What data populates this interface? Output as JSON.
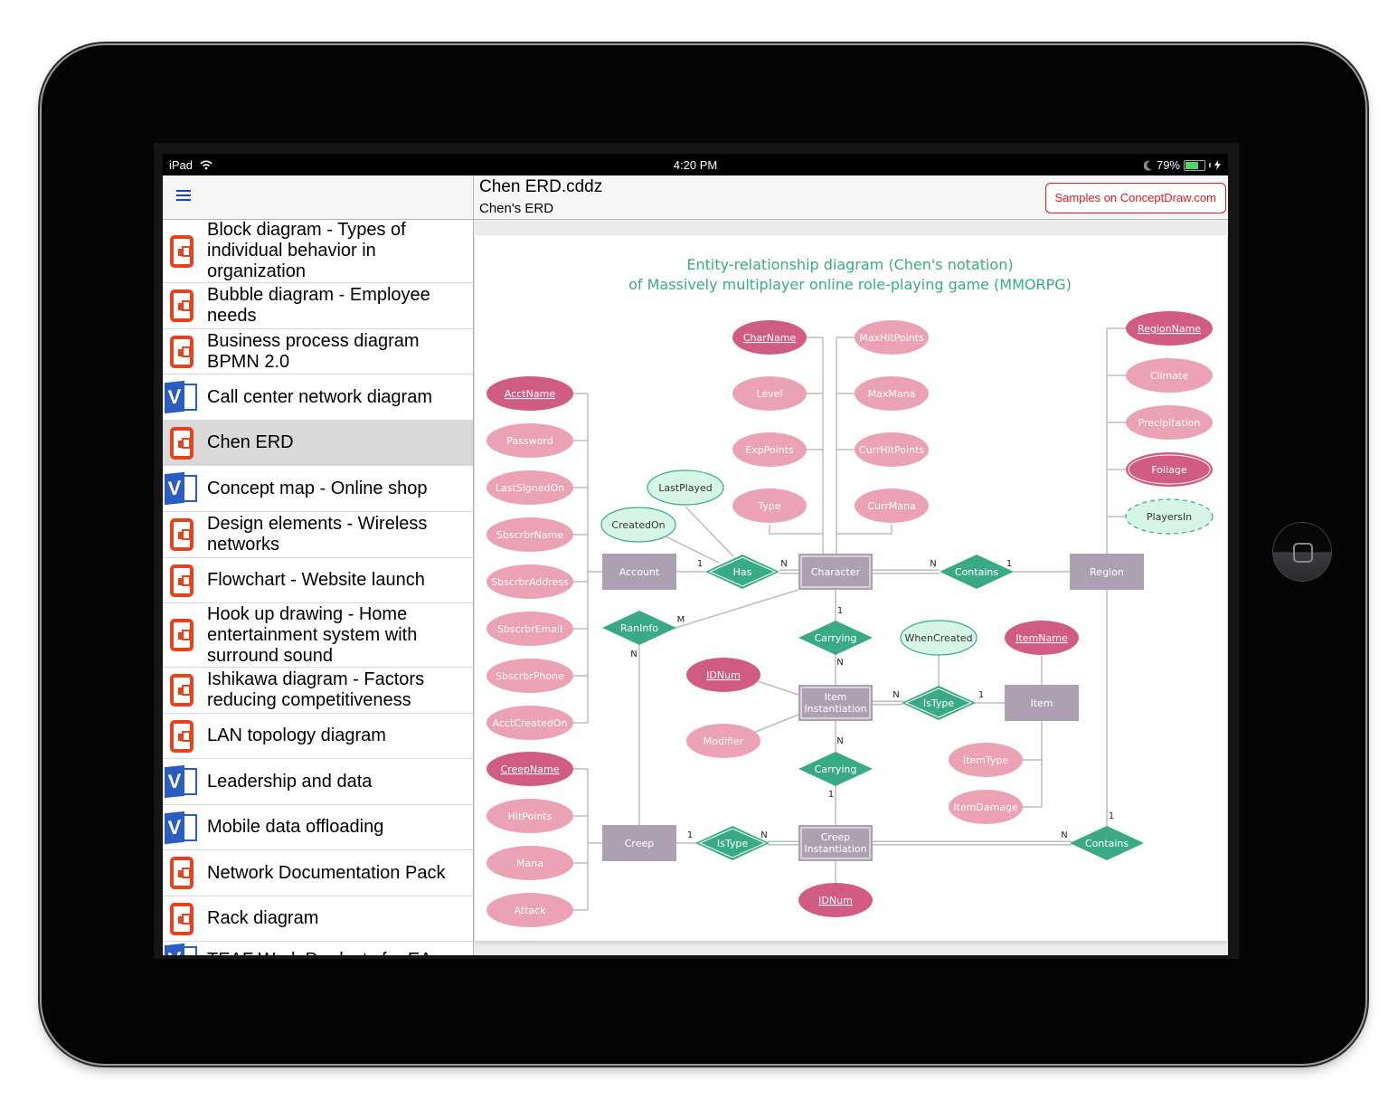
{
  "status_bar": {
    "device": "iPad",
    "time": "4:20 PM",
    "battery": "79%",
    "battery_level": 0.79,
    "icons": [
      "wifi-icon",
      "moon-icon",
      "battery-icon",
      "charging-icon"
    ]
  },
  "sidebar": {
    "menu_icon": "hamburger-menu-icon",
    "items": [
      {
        "label": "Block diagram - Types of individual behavior in organization",
        "icon": "conceptdraw-doc-icon",
        "selected": false
      },
      {
        "label": "Bubble diagram - Employee needs",
        "icon": "conceptdraw-doc-icon",
        "selected": false
      },
      {
        "label": "Business process diagram BPMN 2.0",
        "icon": "conceptdraw-doc-icon",
        "selected": false
      },
      {
        "label": "Call center network diagram",
        "icon": "visio-doc-icon",
        "selected": false
      },
      {
        "label": "Chen ERD",
        "icon": "conceptdraw-doc-icon",
        "selected": true
      },
      {
        "label": "Concept map - Online shop",
        "icon": "visio-doc-icon",
        "selected": false
      },
      {
        "label": "Design elements - Wireless networks",
        "icon": "conceptdraw-doc-icon",
        "selected": false
      },
      {
        "label": "Flowchart - Website launch",
        "icon": "conceptdraw-doc-icon",
        "selected": false
      },
      {
        "label": "Hook up drawing - Home entertainment system with surround sound",
        "icon": "conceptdraw-doc-icon",
        "selected": false
      },
      {
        "label": "Ishikawa diagram - Factors reducing competitiveness",
        "icon": "conceptdraw-doc-icon",
        "selected": false
      },
      {
        "label": "LAN topology diagram",
        "icon": "conceptdraw-doc-icon",
        "selected": false
      },
      {
        "label": "Leadership and data",
        "icon": "visio-doc-icon",
        "selected": false
      },
      {
        "label": "Mobile data offloading",
        "icon": "visio-doc-icon",
        "selected": false
      },
      {
        "label": "Network Documentation Pack",
        "icon": "conceptdraw-doc-icon",
        "selected": false
      },
      {
        "label": "Rack diagram",
        "icon": "conceptdraw-doc-icon",
        "selected": false
      },
      {
        "label": "TEAF Work Products for EA",
        "icon": "visio-doc-icon",
        "selected": false
      }
    ]
  },
  "main": {
    "file_name": "Chen ERD.cddz",
    "page_name": "Chen's ERD",
    "samples_button": "Samples on ConceptDraw.com",
    "colors": {
      "accent_red": "#e3191f",
      "entity": "#ada0b2",
      "relationship": "#3aaa86",
      "key_attr": "#d05c84",
      "attr": "#eaa2b4",
      "derived_attr": "#d7f5e6"
    }
  },
  "diagram": {
    "title_line1": "Entity-relationship diagram (Chen's notation)",
    "title_line2": "of Massively multiplayer online role-playing game (MMORPG)",
    "entities": [
      {
        "id": "account",
        "label": "Account",
        "weak": false
      },
      {
        "id": "character",
        "label": "Character",
        "weak": true
      },
      {
        "id": "region",
        "label": "Region",
        "weak": false
      },
      {
        "id": "item_inst",
        "label": "Item Instantiation",
        "weak": true
      },
      {
        "id": "item",
        "label": "Item",
        "weak": false
      },
      {
        "id": "creep",
        "label": "Creep",
        "weak": false
      },
      {
        "id": "creep_inst",
        "label": "Creep Instantiation",
        "weak": true
      }
    ],
    "relationships": [
      {
        "id": "has",
        "label": "Has",
        "identifying": true
      },
      {
        "id": "contains1",
        "label": "Contains",
        "identifying": false
      },
      {
        "id": "raninfo",
        "label": "RanInfo",
        "identifying": false
      },
      {
        "id": "carrying1",
        "label": "Carrying",
        "identifying": false
      },
      {
        "id": "istype1",
        "label": "IsType",
        "identifying": true
      },
      {
        "id": "carrying2",
        "label": "Carrying",
        "identifying": false
      },
      {
        "id": "istype2",
        "label": "IsType",
        "identifying": true
      },
      {
        "id": "contains2",
        "label": "Contains",
        "identifying": false
      }
    ],
    "attributes": [
      {
        "id": "acctname",
        "label": "AcctName",
        "type": "key"
      },
      {
        "id": "password",
        "label": "Password",
        "type": "normal"
      },
      {
        "id": "lastsignedon",
        "label": "LastSignedOn",
        "type": "normal"
      },
      {
        "id": "sbscrbrname",
        "label": "SbscrbrName",
        "type": "normal"
      },
      {
        "id": "sbscrbraddress",
        "label": "SbscrbrAddress",
        "type": "normal"
      },
      {
        "id": "sbscrbremail",
        "label": "SbscrbrEmail",
        "type": "normal"
      },
      {
        "id": "sbscrbrphone",
        "label": "SbscrbrPhone",
        "type": "normal"
      },
      {
        "id": "acctcreatedon",
        "label": "AcctCreatedOn",
        "type": "normal"
      },
      {
        "id": "charname",
        "label": "CharName",
        "type": "partial-key"
      },
      {
        "id": "level",
        "label": "Level",
        "type": "normal"
      },
      {
        "id": "exppoints",
        "label": "ExpPoints",
        "type": "normal"
      },
      {
        "id": "type",
        "label": "Type",
        "type": "normal"
      },
      {
        "id": "maxhitpoints",
        "label": "MaxHitPoints",
        "type": "normal"
      },
      {
        "id": "maxmana",
        "label": "MaxMana",
        "type": "normal"
      },
      {
        "id": "currhitpoints",
        "label": "CurrHitPoints",
        "type": "normal"
      },
      {
        "id": "currmana",
        "label": "CurrMana",
        "type": "normal"
      },
      {
        "id": "lastplayed",
        "label": "LastPlayed",
        "type": "relationship"
      },
      {
        "id": "createdon",
        "label": "CreatedOn",
        "type": "relationship"
      },
      {
        "id": "regionname",
        "label": "RegionName",
        "type": "key"
      },
      {
        "id": "climate",
        "label": "Climate",
        "type": "normal"
      },
      {
        "id": "precipitation",
        "label": "Precipitation",
        "type": "normal"
      },
      {
        "id": "foliage",
        "label": "Foliage",
        "type": "multivalued"
      },
      {
        "id": "playersin",
        "label": "PlayersIn",
        "type": "derived"
      },
      {
        "id": "whencreated",
        "label": "WhenCreated",
        "type": "relationship"
      },
      {
        "id": "itemname",
        "label": "ItemName",
        "type": "key"
      },
      {
        "id": "idnum1",
        "label": "IDNum",
        "type": "partial-key"
      },
      {
        "id": "modifier",
        "label": "Modifier",
        "type": "normal"
      },
      {
        "id": "itemtype",
        "label": "ItemType",
        "type": "normal"
      },
      {
        "id": "itemdamage",
        "label": "ItemDamage",
        "type": "normal"
      },
      {
        "id": "creepname",
        "label": "CreepName",
        "type": "key"
      },
      {
        "id": "hitpoints",
        "label": "HitPoints",
        "type": "normal"
      },
      {
        "id": "mana",
        "label": "Mana",
        "type": "normal"
      },
      {
        "id": "attack",
        "label": "Attack",
        "type": "normal"
      },
      {
        "id": "idnum2",
        "label": "IDNum",
        "type": "partial-key"
      }
    ],
    "cardinalities": [
      {
        "near": "account-has",
        "value": "1"
      },
      {
        "near": "has-character",
        "value": "N"
      },
      {
        "near": "character-contains",
        "value": "N"
      },
      {
        "near": "contains-region",
        "value": "1"
      },
      {
        "near": "raninfo-character",
        "value": "M"
      },
      {
        "near": "raninfo-creep",
        "value": "N"
      },
      {
        "near": "character-carrying",
        "value": "1"
      },
      {
        "near": "carrying-iteminst",
        "value": "N"
      },
      {
        "near": "iteminst-istype",
        "value": "N"
      },
      {
        "near": "istype-item",
        "value": "1"
      },
      {
        "near": "iteminst-carrying2",
        "value": "N"
      },
      {
        "near": "carrying2-creepinst",
        "value": "1"
      },
      {
        "near": "creep-istype2",
        "value": "1"
      },
      {
        "near": "istype2-creepinst",
        "value": "N"
      },
      {
        "near": "creepinst-contains2",
        "value": "N"
      },
      {
        "near": "contains2-region",
        "value": "1"
      }
    ]
  }
}
